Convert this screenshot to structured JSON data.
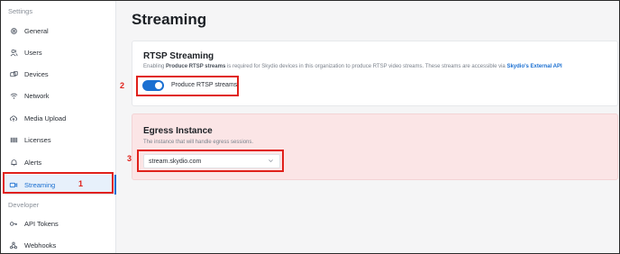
{
  "sidebar": {
    "settings_label": "Settings",
    "developer_label": "Developer",
    "settings_items": [
      {
        "label": "General",
        "icon": "gear-icon"
      },
      {
        "label": "Users",
        "icon": "users-icon"
      },
      {
        "label": "Devices",
        "icon": "devices-icon"
      },
      {
        "label": "Network",
        "icon": "wifi-icon"
      },
      {
        "label": "Media Upload",
        "icon": "cloud-upload-icon"
      },
      {
        "label": "Licenses",
        "icon": "licenses-icon"
      },
      {
        "label": "Alerts",
        "icon": "bell-icon"
      },
      {
        "label": "Streaming",
        "icon": "video-camera-icon",
        "active": true
      }
    ],
    "developer_items": [
      {
        "label": "API Tokens",
        "icon": "key-icon"
      },
      {
        "label": "Webhooks",
        "icon": "webhooks-icon"
      }
    ]
  },
  "page": {
    "title": "Streaming"
  },
  "rtsp": {
    "title": "RTSP Streaming",
    "desc_prefix": "Enabling ",
    "desc_bold": "Produce RTSP streams",
    "desc_middle": " is required for Skydio devices in this organization to produce RTSP video streams. These streams are accessible via ",
    "desc_link": "Skydio's External API",
    "toggle_label": "Produce RTSP streams",
    "toggle_on": true
  },
  "egress": {
    "title": "Egress Instance",
    "desc": "The instance that will handle egress sessions.",
    "selected_value": "stream.skydio.com"
  },
  "annotations": [
    "1",
    "2",
    "3"
  ],
  "colors": {
    "accent": "#1a6fd1",
    "annotation": "#e0201a",
    "egress_bg": "#fbe5e6"
  }
}
